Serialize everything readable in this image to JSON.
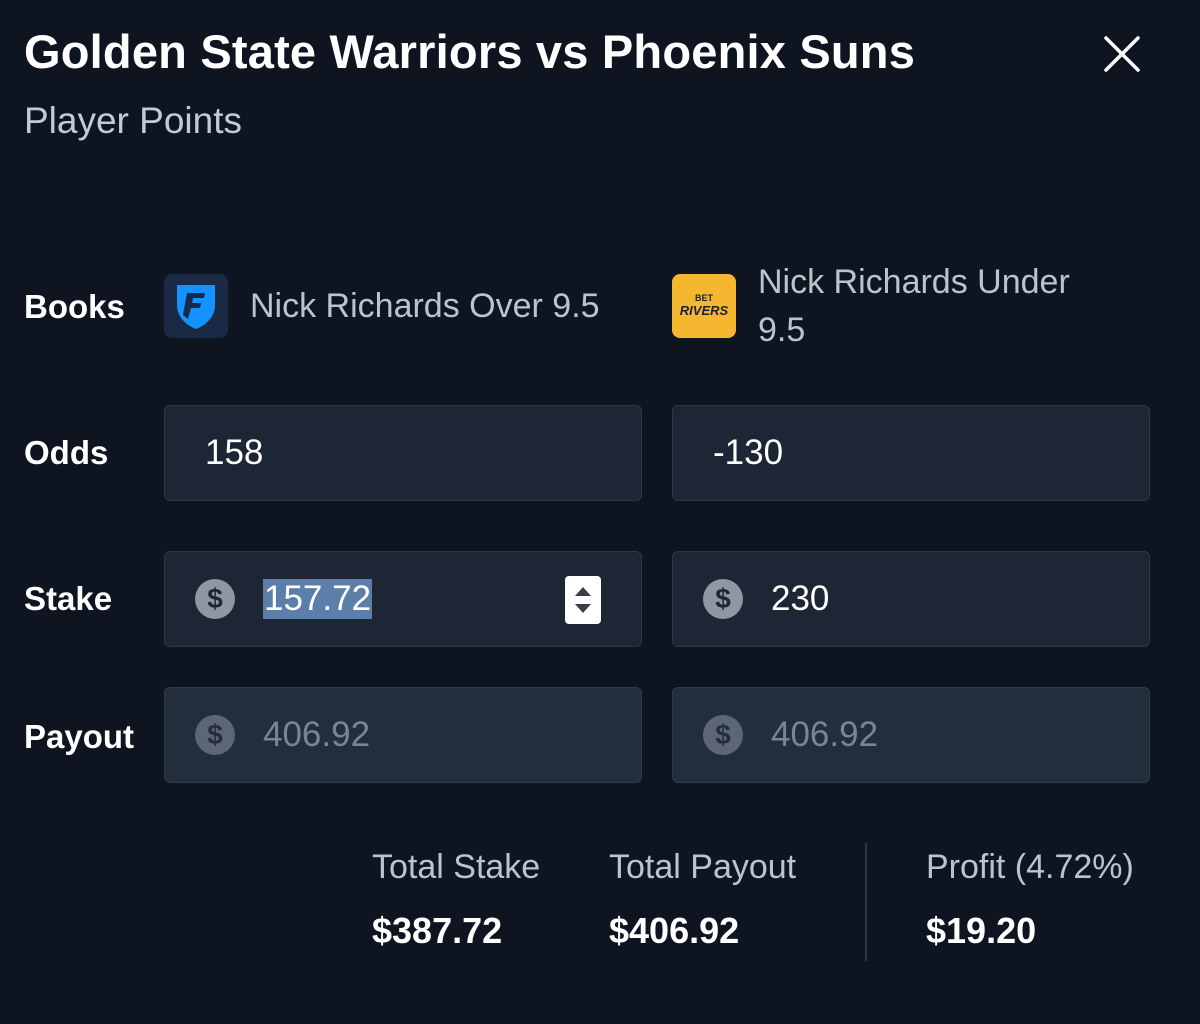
{
  "header": {
    "title": "Golden State Warriors vs Phoenix Suns",
    "subtitle": "Player Points",
    "close_icon": "close-icon"
  },
  "rows": {
    "books_label": "Books",
    "odds_label": "Odds",
    "stake_label": "Stake",
    "payout_label": "Payout"
  },
  "books": [
    {
      "name": "Nick Richards Over 9.5",
      "logo": "fanduel-logo",
      "logo_color": "#1493ff",
      "logo_bg": "#1a2a44"
    },
    {
      "name": "Nick Richards Under 9.5",
      "logo": "betrivers-logo",
      "logo_text_top": "BET",
      "logo_text_bottom": "RIVERS",
      "logo_bg": "#f5b730"
    }
  ],
  "odds": [
    "158",
    "-130"
  ],
  "stake": [
    "157.72",
    "230"
  ],
  "payout": [
    "406.92",
    "406.92"
  ],
  "summary": {
    "total_stake_label": "Total Stake",
    "total_stake_value": "$387.72",
    "total_payout_label": "Total Payout",
    "total_payout_value": "$406.92",
    "profit_label": "Profit (4.72%)",
    "profit_value": "$19.20"
  },
  "colors": {
    "background": "#0e1520",
    "field": "#1c2634",
    "field_disabled": "#232e3d",
    "selection": "#5c7faa"
  }
}
